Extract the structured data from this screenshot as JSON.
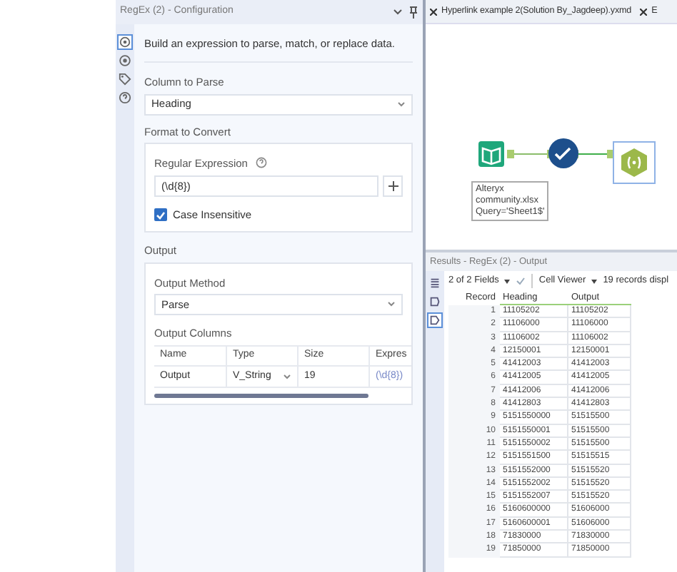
{
  "config": {
    "title": "RegEx (2) - Configuration",
    "side_tabs": [
      {
        "kind": "gear",
        "selected": true
      },
      {
        "kind": "target",
        "selected": false
      },
      {
        "kind": "tag",
        "selected": false
      },
      {
        "kind": "help",
        "selected": false
      }
    ],
    "description": "Build an expression to parse, match, or replace data.",
    "column_to_parse": {
      "label": "Column to Parse",
      "value": "Heading"
    },
    "format_to_convert": {
      "title": "Format to Convert",
      "regex_label": "Regular Expression",
      "regex_value": "(\\d{8})",
      "case_insensitive": {
        "label": "Case Insensitive",
        "checked": true
      }
    },
    "output": {
      "title": "Output",
      "method_label": "Output Method",
      "method_value": "Parse",
      "columns_label": "Output Columns",
      "headers": [
        "Name",
        "Type",
        "Size",
        "Expres"
      ],
      "rows": [
        [
          "Output",
          "V_String",
          "19",
          "(\\d{8})"
        ]
      ]
    }
  },
  "workflow": {
    "tabs": [
      {
        "label": "Hyperlink example 2(Solution By_Jagdeep).yxmd"
      },
      {
        "label": "E"
      }
    ],
    "annotation": [
      "Alteryx",
      "community.xlsx",
      "Query='Sheet1$'"
    ]
  },
  "results": {
    "title": "Results - RegEx (2) - Output",
    "side_tabs": [
      {
        "selected": false
      },
      {
        "selected": false
      },
      {
        "selected": true
      }
    ],
    "fields": "2 of 2 Fields",
    "viewer": "Cell Viewer",
    "records": "19 records displ",
    "columns": [
      "Record",
      "Heading",
      "Output"
    ],
    "rows": [
      [
        "1",
        "11105202",
        "11105202"
      ],
      [
        "2",
        "11106000",
        "11106000"
      ],
      [
        "3",
        "11106002",
        "11106002"
      ],
      [
        "4",
        "12150001",
        "12150001"
      ],
      [
        "5",
        "41412003",
        "41412003"
      ],
      [
        "6",
        "41412005",
        "41412005"
      ],
      [
        "7",
        "41412006",
        "41412006"
      ],
      [
        "8",
        "41412803",
        "41412803"
      ],
      [
        "9",
        "5151550000",
        "51515500"
      ],
      [
        "10",
        "5151550001",
        "51515500"
      ],
      [
        "11",
        "5151550002",
        "51515500"
      ],
      [
        "12",
        "5151551500",
        "51515515"
      ],
      [
        "13",
        "5151552000",
        "51515520"
      ],
      [
        "14",
        "5151552002",
        "51515520"
      ],
      [
        "15",
        "5151552007",
        "51515520"
      ],
      [
        "16",
        "5160600000",
        "51606000"
      ],
      [
        "17",
        "5160600001",
        "51606000"
      ],
      [
        "18",
        "71830000",
        "71830000"
      ],
      [
        "19",
        "71850000",
        "71850000"
      ]
    ]
  }
}
